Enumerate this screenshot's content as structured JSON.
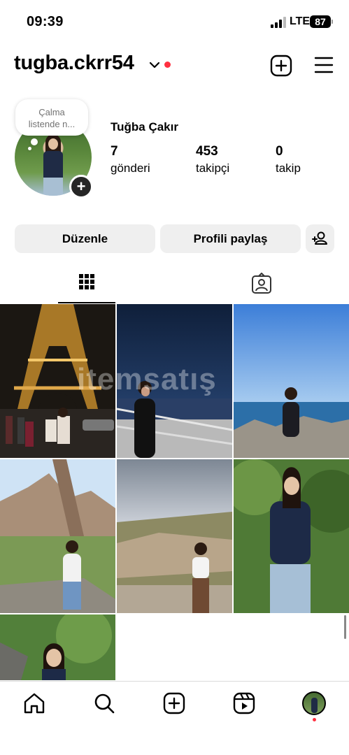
{
  "status_bar": {
    "time": "09:39",
    "network": "LTE",
    "battery": "87"
  },
  "header": {
    "username": "tugba.ckrr54"
  },
  "profile": {
    "note_line1": "Çalma",
    "note_line2": "listende n...",
    "full_name": "Tuğba Çakır",
    "stats": [
      {
        "value": "7",
        "label": "gönderi"
      },
      {
        "value": "453",
        "label": "takipçi"
      },
      {
        "value": "0",
        "label": "takip"
      }
    ]
  },
  "actions": {
    "edit_label": "Düzenle",
    "share_label": "Profili paylaş"
  },
  "tabs": [
    {
      "icon": "grid-icon",
      "active": true
    },
    {
      "icon": "tagged-icon",
      "active": false
    }
  ],
  "watermark": "itemsatış",
  "colors": {
    "accent_red": "#ff3040",
    "button_bg": "#efefef",
    "divider": "#dbdbdb"
  },
  "posts_count_visible": 7,
  "bottom_nav": [
    {
      "icon": "home-icon"
    },
    {
      "icon": "search-icon"
    },
    {
      "icon": "create-icon"
    },
    {
      "icon": "reels-icon"
    },
    {
      "icon": "profile-avatar"
    }
  ]
}
